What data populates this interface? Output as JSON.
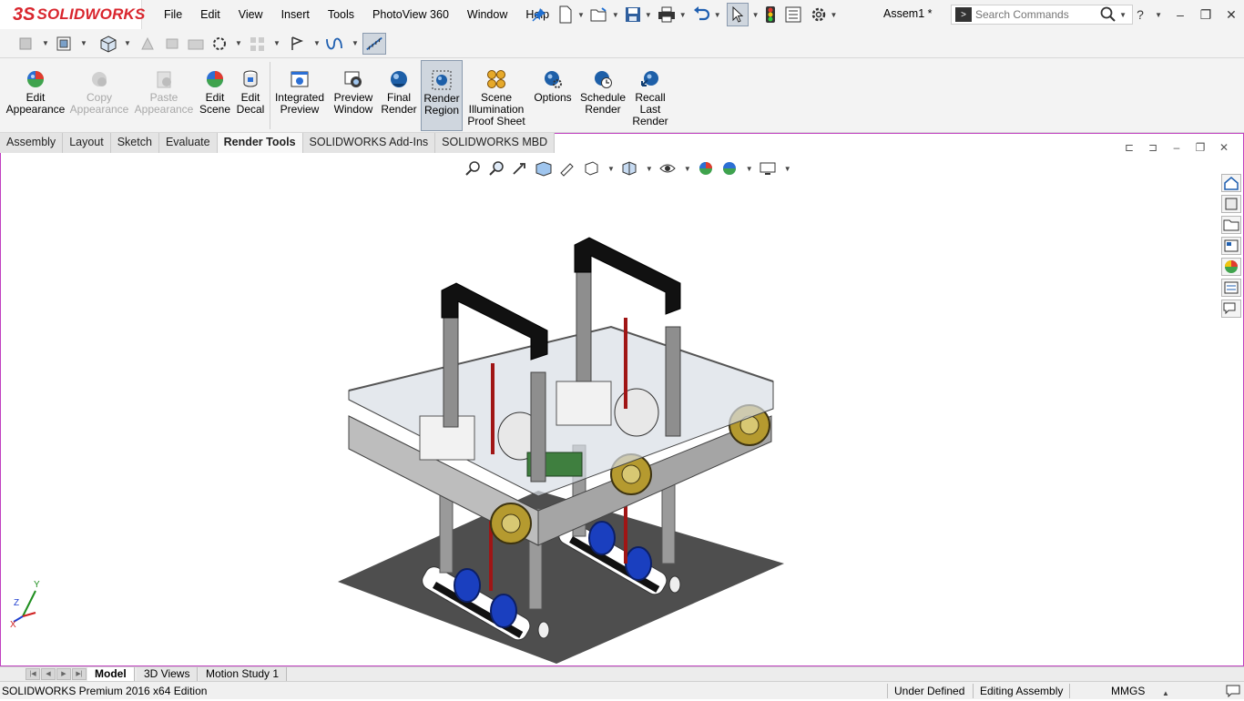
{
  "app": {
    "brand_ds": "3S",
    "brand_name": "SOLIDWORKS"
  },
  "menu": [
    "File",
    "Edit",
    "View",
    "Insert",
    "Tools",
    "PhotoView 360",
    "Window",
    "Help"
  ],
  "document_title": "Assem1 *",
  "search": {
    "placeholder": "Search Commands"
  },
  "ribbon": {
    "buttons": [
      {
        "label1": "Edit",
        "label2": "Appearance",
        "label3": "",
        "icon": "appearance-sphere-icon",
        "state": "enabled"
      },
      {
        "label1": "Copy",
        "label2": "Appearance",
        "label3": "",
        "icon": "copy-appearance-icon",
        "state": "disabled"
      },
      {
        "label1": "Paste",
        "label2": "Appearance",
        "label3": "",
        "icon": "paste-appearance-icon",
        "state": "disabled"
      },
      {
        "label1": "Edit",
        "label2": "Scene",
        "label3": "",
        "icon": "scene-sphere-icon",
        "state": "enabled"
      },
      {
        "label1": "Edit",
        "label2": "Decal",
        "label3": "",
        "icon": "decal-icon",
        "state": "enabled"
      },
      {
        "label1": "Integrated",
        "label2": "Preview",
        "label3": "",
        "icon": "integrated-preview-icon",
        "state": "enabled"
      },
      {
        "label1": "Preview",
        "label2": "Window",
        "label3": "",
        "icon": "preview-window-icon",
        "state": "enabled"
      },
      {
        "label1": "Final",
        "label2": "Render",
        "label3": "",
        "icon": "final-render-icon",
        "state": "enabled"
      },
      {
        "label1": "Render",
        "label2": "Region",
        "label3": "",
        "icon": "render-region-icon",
        "state": "active"
      },
      {
        "label1": "Scene",
        "label2": "Illumination",
        "label3": "Proof Sheet",
        "icon": "illumination-proof-icon",
        "state": "enabled"
      },
      {
        "label1": "Options",
        "label2": "",
        "label3": "",
        "icon": "options-gear-icon",
        "state": "enabled"
      },
      {
        "label1": "Schedule",
        "label2": "Render",
        "label3": "",
        "icon": "schedule-render-icon",
        "state": "enabled"
      },
      {
        "label1": "Recall",
        "label2": "Last",
        "label3": "Render",
        "icon": "recall-render-icon",
        "state": "enabled"
      }
    ]
  },
  "command_tabs": [
    "Assembly",
    "Layout",
    "Sketch",
    "Evaluate",
    "Render Tools",
    "SOLIDWORKS Add-Ins",
    "SOLIDWORKS MBD"
  ],
  "active_command_tab": "Render Tools",
  "bottom_tabs": [
    "Model",
    "3D Views",
    "Motion Study 1"
  ],
  "active_bottom_tab": "Model",
  "status": {
    "product": "SOLIDWORKS Premium 2016 x64 Edition",
    "constraint": "Under Defined",
    "mode": "Editing Assembly",
    "units": "MMGS"
  },
  "colors": {
    "brand": "#d9262e",
    "viewport_border": "#c040c0",
    "active_ribbon": "#cfd6de"
  },
  "triad": {
    "x": "X",
    "y": "Y",
    "z": "Z"
  }
}
